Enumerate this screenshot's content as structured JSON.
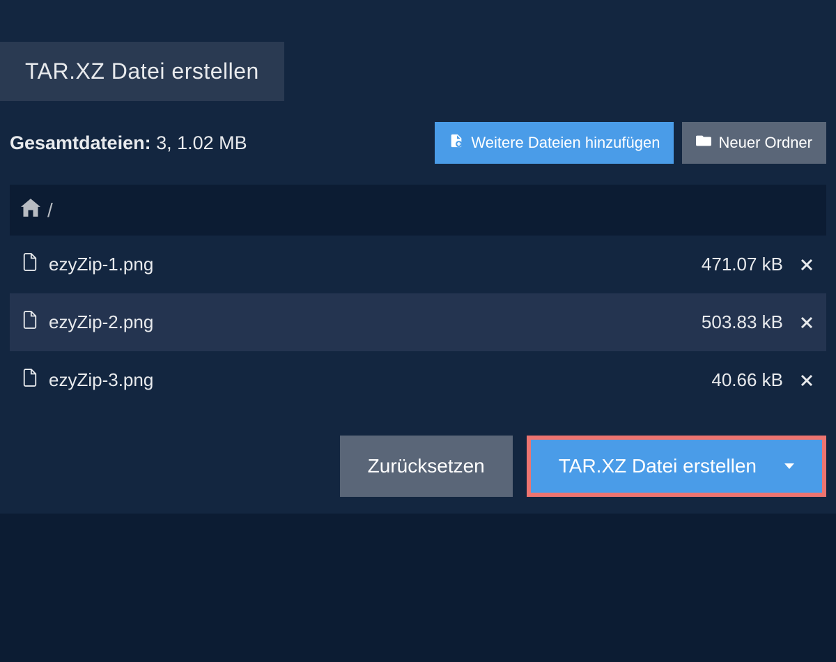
{
  "tab": {
    "title": "TAR.XZ Datei erstellen"
  },
  "summary": {
    "label": "Gesamtdateien:",
    "value": "3, 1.02 MB"
  },
  "toolbar": {
    "add_files_label": "Weitere Dateien hinzufügen",
    "new_folder_label": "Neuer Ordner"
  },
  "breadcrumb": {
    "path": "/"
  },
  "files": [
    {
      "name": "ezyZip-1.png",
      "size": "471.07 kB"
    },
    {
      "name": "ezyZip-2.png",
      "size": "503.83 kB"
    },
    {
      "name": "ezyZip-3.png",
      "size": "40.66 kB"
    }
  ],
  "actions": {
    "reset_label": "Zurücksetzen",
    "create_label": "TAR.XZ Datei erstellen"
  },
  "colors": {
    "accent": "#4a9ce8",
    "highlight_border": "#ed7470",
    "bg_dark": "#0c1c33",
    "bg_panel": "#132640"
  }
}
